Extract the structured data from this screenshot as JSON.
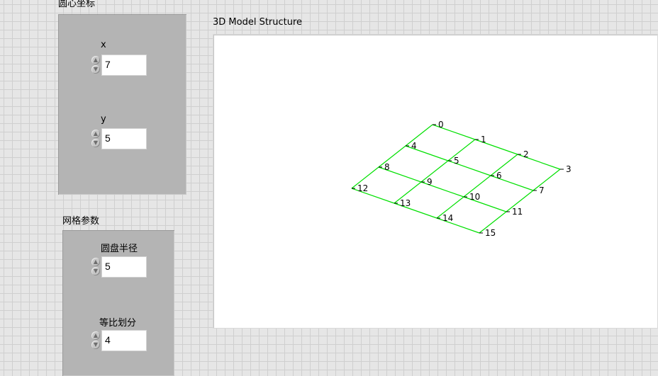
{
  "center_group": {
    "title": "圆心坐标",
    "x": {
      "label": "x",
      "value": "7"
    },
    "y": {
      "label": "y",
      "value": "5"
    }
  },
  "mesh_group": {
    "title": "网格参数",
    "radius": {
      "label": "圆盘半径",
      "value": "5"
    },
    "divisions": {
      "label": "等比划分",
      "value": "4"
    }
  },
  "graph": {
    "title": "3D Model Structure",
    "line_color": "#00e000",
    "nodes": [
      {
        "id": "0",
        "label": "0"
      },
      {
        "id": "1",
        "label": "1"
      },
      {
        "id": "2",
        "label": "2"
      },
      {
        "id": "3",
        "label": "3"
      },
      {
        "id": "4",
        "label": "4"
      },
      {
        "id": "5",
        "label": "5"
      },
      {
        "id": "6",
        "label": "6"
      },
      {
        "id": "7",
        "label": "7"
      },
      {
        "id": "8",
        "label": "8"
      },
      {
        "id": "9",
        "label": "9"
      },
      {
        "id": "10",
        "label": "10"
      },
      {
        "id": "11",
        "label": "11"
      },
      {
        "id": "12",
        "label": "12"
      },
      {
        "id": "13",
        "label": "13"
      },
      {
        "id": "14",
        "label": "14"
      },
      {
        "id": "15",
        "label": "15"
      }
    ]
  },
  "icons": {
    "spin_up": "spin-up-icon",
    "spin_down": "spin-down-icon"
  }
}
